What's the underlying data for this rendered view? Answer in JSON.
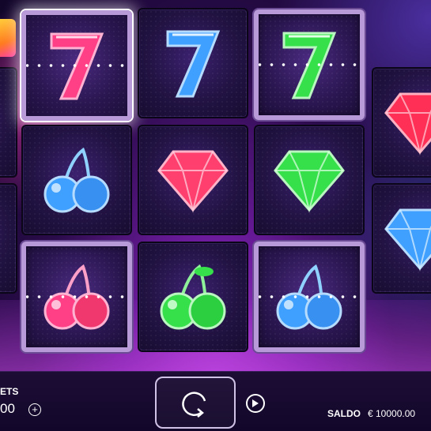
{
  "game": {
    "grid": [
      {
        "id": "r0a",
        "symbol": "seven",
        "color": "pink"
      },
      {
        "id": "r1a",
        "symbol": "seven",
        "color": "blue"
      },
      {
        "id": "r2a",
        "symbol": "seven",
        "color": "green"
      },
      {
        "id": "r3a",
        "symbol": "gem",
        "color": "red"
      },
      {
        "id": "r0b",
        "symbol": "cherry",
        "color": "blue"
      },
      {
        "id": "r1b",
        "symbol": "gem",
        "color": "pink"
      },
      {
        "id": "r2b",
        "symbol": "gem",
        "color": "green"
      },
      {
        "id": "r3b",
        "symbol": "gem",
        "color": "blue"
      },
      {
        "id": "r0c",
        "symbol": "cherry",
        "color": "pink"
      },
      {
        "id": "r1c",
        "symbol": "cherry",
        "color": "green"
      },
      {
        "id": "r2c",
        "symbol": "cherry",
        "color": "blue"
      }
    ]
  },
  "footer": {
    "bets_label": "ETS",
    "bets_value": "00",
    "plus_symbol": "+",
    "balance_label": "SALDO",
    "balance_value": "€ 10000.00"
  },
  "icons": {
    "spin": "spin-arrow-icon",
    "autoplay": "play-icon",
    "plus": "plus-icon"
  },
  "colors": {
    "pink": "#ff3f86",
    "blue": "#3fa0ff",
    "green": "#35e04a",
    "red": "#ff2f55"
  }
}
